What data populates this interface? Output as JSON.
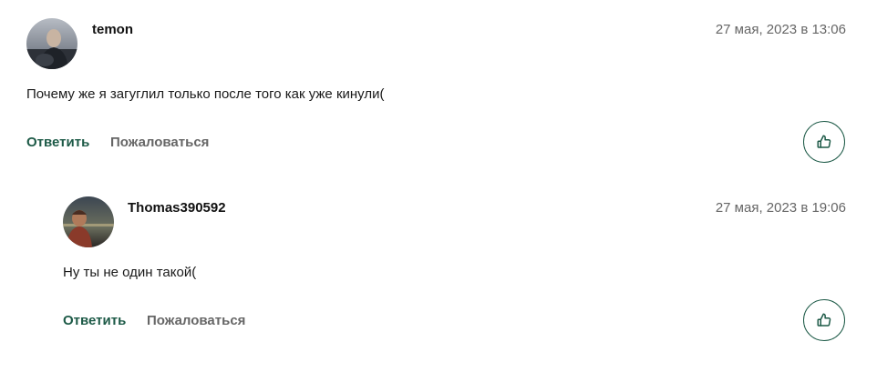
{
  "comments": [
    {
      "username": "temon",
      "date": "27 мая, 2023 в 13:06",
      "text": "Почему же я загуглил только после того как уже кинули(",
      "reply_label": "Ответить",
      "report_label": "Пожаловаться",
      "like_icon": "thumbs-up-icon"
    },
    {
      "username": "Thomas390592",
      "date": "27 мая, 2023 в 19:06",
      "text": "Ну ты не один такой(",
      "reply_label": "Ответить",
      "report_label": "Пожаловаться",
      "like_icon": "thumbs-up-icon"
    }
  ],
  "colors": {
    "accent": "#1d5a47",
    "muted": "#666666",
    "text": "#1a1a1a"
  }
}
